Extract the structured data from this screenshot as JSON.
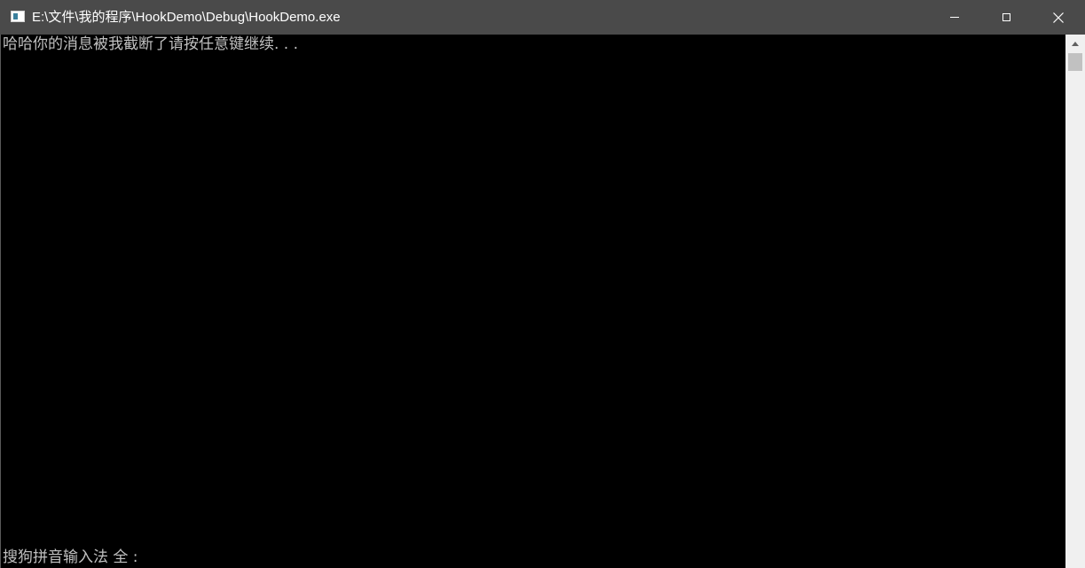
{
  "window": {
    "title": "E:\\文件\\我的程序\\HookDemo\\Debug\\HookDemo.exe",
    "icon": "console-app-icon",
    "controls": {
      "minimize_icon": "minimize-icon",
      "maximize_icon": "maximize-icon",
      "close_icon": "close-icon",
      "close_glyph": "✕"
    }
  },
  "console": {
    "lines": [
      "哈哈你的消息被我截断了请按任意键继续. . ."
    ],
    "ime_status": "搜狗拼音输入法 全 :",
    "text_color": "#c0c0c0",
    "background": "#000000"
  },
  "scrollbar": {
    "up_arrow": "▲"
  }
}
